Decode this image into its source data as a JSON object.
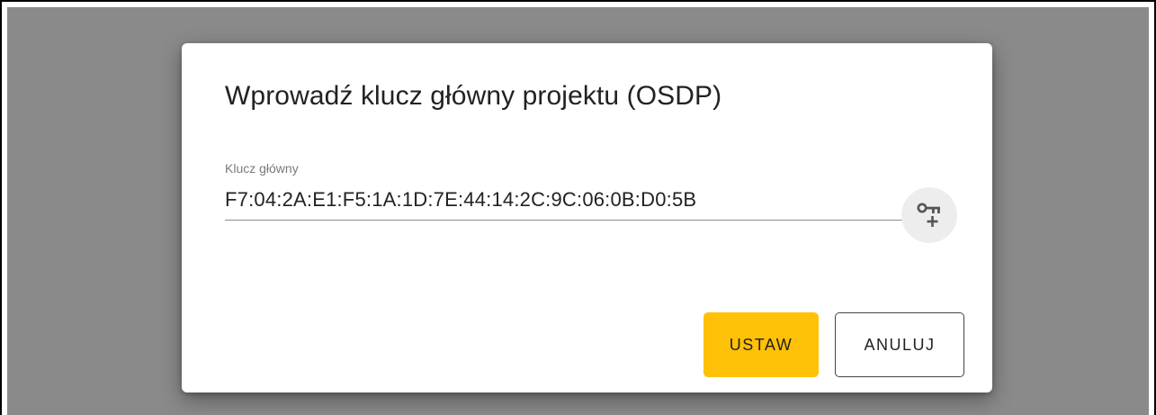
{
  "dialog": {
    "title": "Wprowadź klucz główny projektu (OSDP)",
    "field": {
      "label": "Klucz główny",
      "value": "F7:04:2A:E1:F5:1A:1D:7E:44:14:2C:9C:06:0B:D0:5B"
    },
    "key_button_icon": "key-plus-icon",
    "buttons": {
      "set_label": "USTAW",
      "cancel_label": "ANULUJ"
    }
  },
  "colors": {
    "backdrop": "#8a8a8a",
    "primary_button": "#ffc107"
  }
}
